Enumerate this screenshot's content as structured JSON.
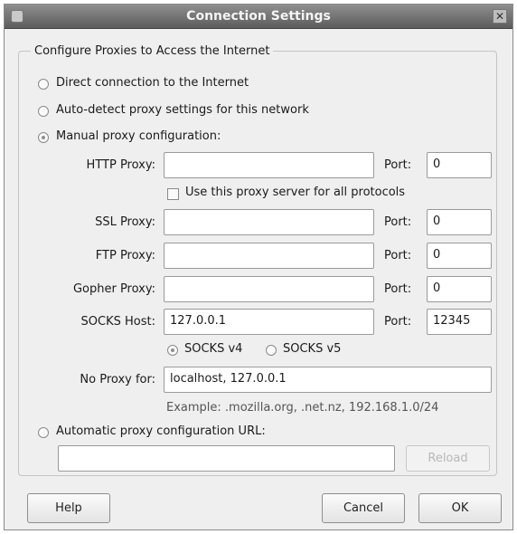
{
  "window": {
    "title": "Connection Settings"
  },
  "group_title": "Configure Proxies to Access the Internet",
  "options": {
    "direct": "Direct connection to the Internet",
    "auto_detect": "Auto-detect proxy settings for this network",
    "manual": "Manual proxy configuration:",
    "auto_url": "Automatic proxy configuration URL:"
  },
  "http": {
    "label": "HTTP Proxy:",
    "value": "",
    "port_label": "Port:",
    "port": "0"
  },
  "use_for_all": "Use this proxy server for all protocols",
  "ssl": {
    "label": "SSL Proxy:",
    "value": "",
    "port_label": "Port:",
    "port": "0"
  },
  "ftp": {
    "label": "FTP Proxy:",
    "value": "",
    "port_label": "Port:",
    "port": "0"
  },
  "gopher": {
    "label": "Gopher Proxy:",
    "value": "",
    "port_label": "Port:",
    "port": "0"
  },
  "socks": {
    "label": "SOCKS Host:",
    "value": "127.0.0.1",
    "port_label": "Port:",
    "port": "12345",
    "v4": "SOCKS v4",
    "v5": "SOCKS v5"
  },
  "no_proxy": {
    "label": "No Proxy for:",
    "value": "localhost, 127.0.0.1"
  },
  "example": "Example: .mozilla.org, .net.nz, 192.168.1.0/24",
  "auto_url_value": "",
  "reload_label": "Reload",
  "buttons": {
    "help": "Help",
    "cancel": "Cancel",
    "ok": "OK"
  },
  "selected_mode": "manual",
  "socks_version": "v4"
}
